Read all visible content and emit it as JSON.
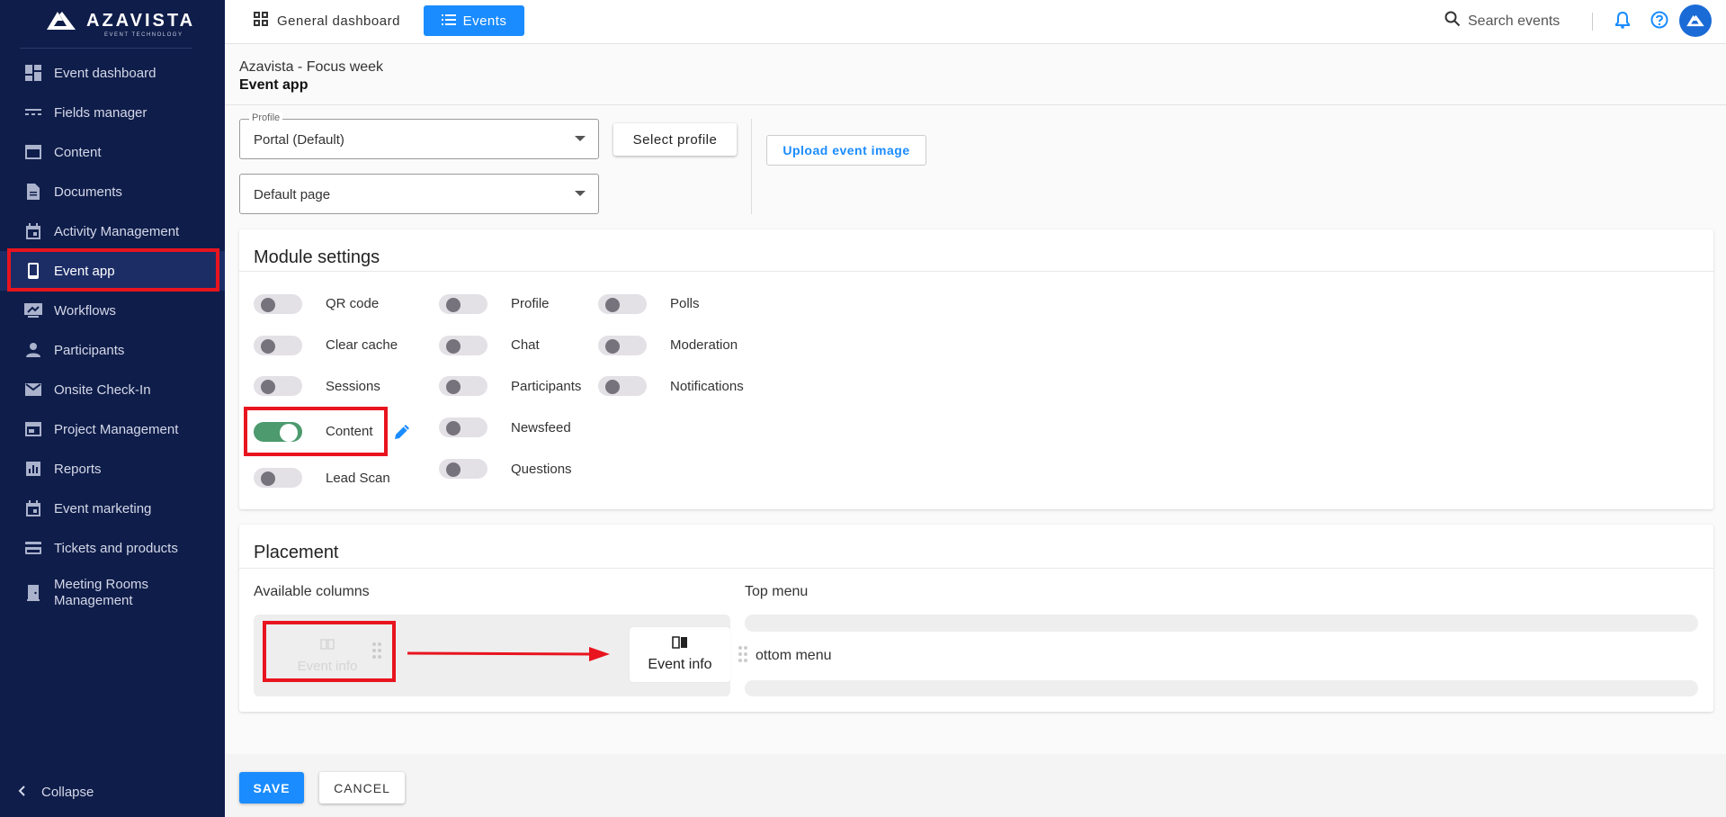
{
  "brand": {
    "name": "AZAVISTA",
    "tagline": "EVENT TECHNOLOGY"
  },
  "sidebar": {
    "items": [
      {
        "label": "Event dashboard",
        "icon": "dashboard-icon"
      },
      {
        "label": "Fields manager",
        "icon": "fields-icon"
      },
      {
        "label": "Content",
        "icon": "content-icon"
      },
      {
        "label": "Documents",
        "icon": "document-icon"
      },
      {
        "label": "Activity Management",
        "icon": "calendar-icon"
      },
      {
        "label": "Event app",
        "icon": "phone-icon",
        "active": true
      },
      {
        "label": "Workflows",
        "icon": "workflow-icon"
      },
      {
        "label": "Participants",
        "icon": "person-icon"
      },
      {
        "label": "Onsite Check-In",
        "icon": "mail-icon"
      },
      {
        "label": "Project Management",
        "icon": "project-icon"
      },
      {
        "label": "Reports",
        "icon": "reports-icon"
      },
      {
        "label": "Event marketing",
        "icon": "calendar-icon"
      },
      {
        "label": "Tickets and products",
        "icon": "card-icon"
      },
      {
        "label": "Meeting Rooms Management",
        "icon": "door-icon"
      }
    ],
    "collapse_label": "Collapse"
  },
  "topbar": {
    "tab_general": "General dashboard",
    "tab_events": "Events",
    "search_placeholder": "Search events"
  },
  "header": {
    "event_name": "Azavista - Focus week",
    "page_title": "Event app"
  },
  "profile": {
    "label": "Profile",
    "value": "Portal (Default)",
    "default_page": "Default page",
    "select_profile": "Select profile",
    "upload_image": "Upload event image"
  },
  "modules": {
    "title": "Module settings",
    "toggles": [
      {
        "label": "QR code",
        "on": false
      },
      {
        "label": "Clear cache",
        "on": false
      },
      {
        "label": "Sessions",
        "on": false
      },
      {
        "label": "Content",
        "on": true
      },
      {
        "label": "Lead Scan",
        "on": false
      },
      {
        "label": "Profile",
        "on": false
      },
      {
        "label": "Chat",
        "on": false
      },
      {
        "label": "Participants",
        "on": false
      },
      {
        "label": "Newsfeed",
        "on": false
      },
      {
        "label": "Questions",
        "on": false
      },
      {
        "label": "Polls",
        "on": false
      },
      {
        "label": "Moderation",
        "on": false
      },
      {
        "label": "Notifications",
        "on": false
      }
    ]
  },
  "placement": {
    "title": "Placement",
    "available_columns": "Available columns",
    "top_menu": "Top menu",
    "bottom_menu_visible": "ottom menu",
    "ghost_item": "Event info",
    "drag_item": "Event info"
  },
  "actions": {
    "save": "SAVE",
    "cancel": "CANCEL"
  },
  "colors": {
    "accent": "#1a8cff",
    "sidebar": "#0f1d4a",
    "toggle_on": "#4c9a6e",
    "highlight": "#e8141e"
  }
}
